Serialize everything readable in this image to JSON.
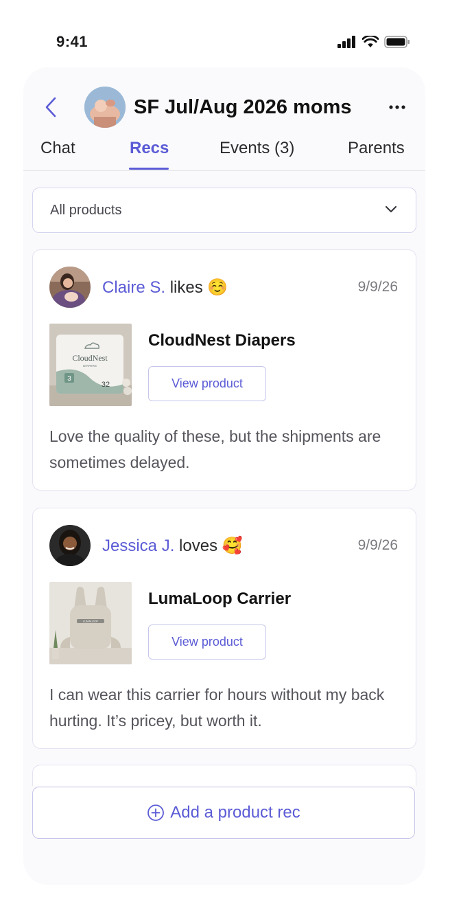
{
  "status_bar": {
    "time": "9:41"
  },
  "header": {
    "title": "SF Jul/Aug 2026 moms",
    "tabs": [
      {
        "label": "Chat",
        "active": false
      },
      {
        "label": "Recs",
        "active": true
      },
      {
        "label": "Events (3)",
        "active": false
      },
      {
        "label": "Parents",
        "active": false
      }
    ]
  },
  "filter": {
    "selected": "All products"
  },
  "recs": [
    {
      "user": "Claire S.",
      "verb": "likes",
      "emoji": "☺️",
      "date": "9/9/26",
      "product": "CloudNest Diapers",
      "button": "View product",
      "comment": "Love the quality of these, but the shipments are sometimes delayed.",
      "package_brand": "CloudNest",
      "package_sub": "DIAPERS",
      "package_size": "3",
      "package_count": "32"
    },
    {
      "user": "Jessica J.",
      "verb": "loves",
      "emoji": "🥰",
      "date": "9/9/26",
      "product": "LumaLoop Carrier",
      "button": "View product",
      "comment": "I can wear this carrier for hours without my back hurting. It’s pricey, but worth it.",
      "carrier_tag": "LUMALOOP"
    }
  ],
  "add_rec": {
    "label": "Add a product rec"
  },
  "colors": {
    "accent": "#5b5bd6",
    "text": "#1c1c1e",
    "muted": "#7a7a80",
    "border": "#e4e4f2"
  },
  "icons": [
    "signal-icon",
    "wifi-icon",
    "battery-icon",
    "back-chevron-icon",
    "more-dots-icon",
    "chevron-down-icon",
    "plus-circle-icon"
  ]
}
